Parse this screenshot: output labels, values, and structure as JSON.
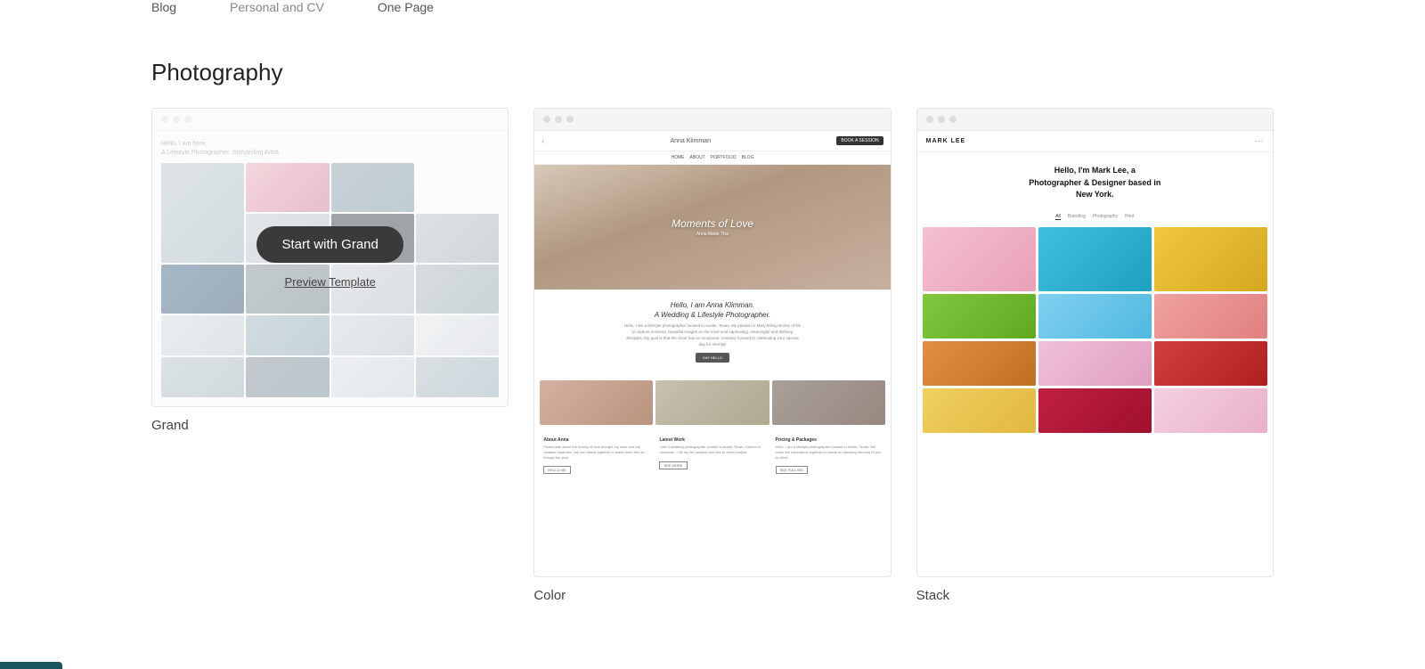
{
  "topNav": {
    "items": [
      {
        "label": "Blog",
        "active": false
      },
      {
        "label": "Personal and CV",
        "active": false
      },
      {
        "label": "One Page",
        "active": false
      }
    ]
  },
  "section": {
    "title": "Photography"
  },
  "templates": [
    {
      "id": "grand",
      "name": "Grand",
      "startLabel": "Start with Grand",
      "previewLabel": "Preview Template",
      "hovered": true
    },
    {
      "id": "color",
      "name": "Color",
      "navBrand": "Anna Klimman",
      "heroTitle": "Moments of Love",
      "heroSub": "Anna Made This",
      "aboutTitle": "Hello, I am Anna Klimman.\nA Wedding & Lifestyle Photographer.",
      "aboutText": "Hello, I am a lifestyle photographer located in Austin, Texas. My passion is Mary telling stories of life to capture timeless, beautiful images on the most soul captivating, meaningful and defining lifestyles. My goal is that the client has an emotional, romantic forward to celebrating your special day for eternity!",
      "btnLabel": "SAY HELLO",
      "sections": [
        {
          "title": "About Anna",
          "text": "Passionate about the beauty of love thought my work and my creative expertise I tell our clients together to make them feel as though the year",
          "btn": "HELLO ME"
        },
        {
          "title": "Latest Work",
          "text": "I am a wedding photographer located in Austin Texas. Carries of moments - I lift my life passion and skill to every project.",
          "btn": "SEE MORE"
        },
        {
          "title": "Pricing & Packages",
          "text": "Hello, I am a lifestyle photographer located in Austin, Texas. We value the experience together to create an amazing memory of you to relive.",
          "btn": "SEE FULL BIO"
        }
      ]
    },
    {
      "id": "stack",
      "name": "Stack",
      "brand": "MARK LEE",
      "heroTitle": "Hello, I'm Mark Lee, a\nPhotographer & Designer based in\nNew York.",
      "filters": [
        "All",
        "Branding",
        "Photography",
        "Print"
      ],
      "activeFilter": "All"
    }
  ]
}
